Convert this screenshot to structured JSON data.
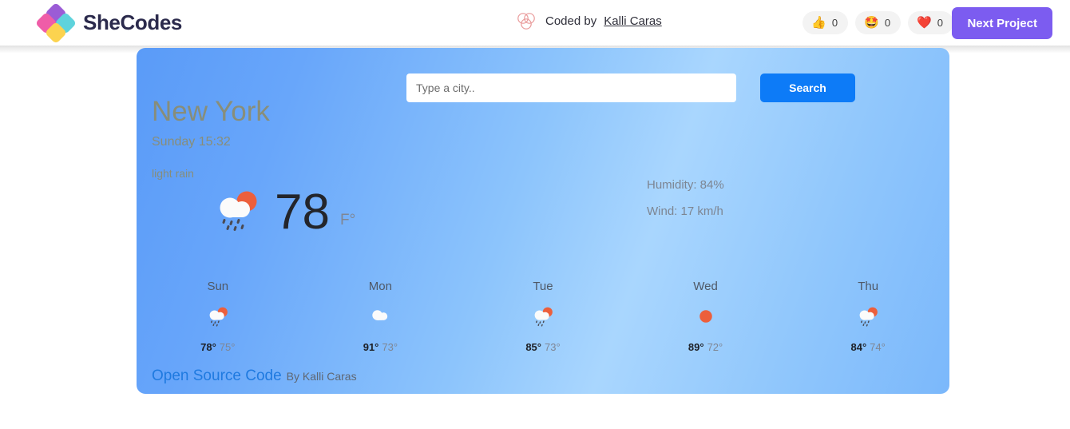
{
  "header": {
    "brand_name": "SheCodes",
    "logo_icon": "shecodes-diamond-logo",
    "coded_by_prefix": "Coded by",
    "coded_by_author": "Kalli Caras",
    "coded_by_icon": "three-overlapping-circles-icon",
    "reactions": [
      {
        "icon": "thumbs-up-emoji",
        "glyph": "👍",
        "count": "0"
      },
      {
        "icon": "star-struck-emoji",
        "glyph": "🤩",
        "count": "0"
      },
      {
        "icon": "red-heart-emoji",
        "glyph": "❤️",
        "count": "0"
      }
    ],
    "next_project_label": "Next Project",
    "next_project_color": "#7c5cf0"
  },
  "search": {
    "placeholder": "Type a city..",
    "value": "",
    "button_label": "Search",
    "button_color": "#0d7bf7"
  },
  "current": {
    "city": "New York",
    "datetime": "Sunday 15:32",
    "description": "light rain",
    "icon": "rain-with-sun-icon",
    "temperature": "78",
    "unit": "F°",
    "humidity": "Humidity: 84%",
    "wind": "Wind: 17 km/h"
  },
  "forecast": [
    {
      "day": "Sun",
      "icon": "rain-with-sun-icon",
      "max": "78°",
      "min": "75°"
    },
    {
      "day": "Mon",
      "icon": "cloud-icon",
      "max": "91°",
      "min": "73°"
    },
    {
      "day": "Tue",
      "icon": "rain-with-sun-icon",
      "max": "85°",
      "min": "73°"
    },
    {
      "day": "Wed",
      "icon": "sun-icon",
      "max": "89°",
      "min": "72°"
    },
    {
      "day": "Thu",
      "icon": "rain-with-sun-icon",
      "max": "84°",
      "min": "74°"
    }
  ],
  "footer": {
    "open_source_label": "Open Source Code",
    "by_author_label": "By Kalli Caras",
    "link_color": "#1f7ae0"
  },
  "card": {
    "gradient_from": "#5a9bf8",
    "gradient_to": "#a9d6fe"
  }
}
